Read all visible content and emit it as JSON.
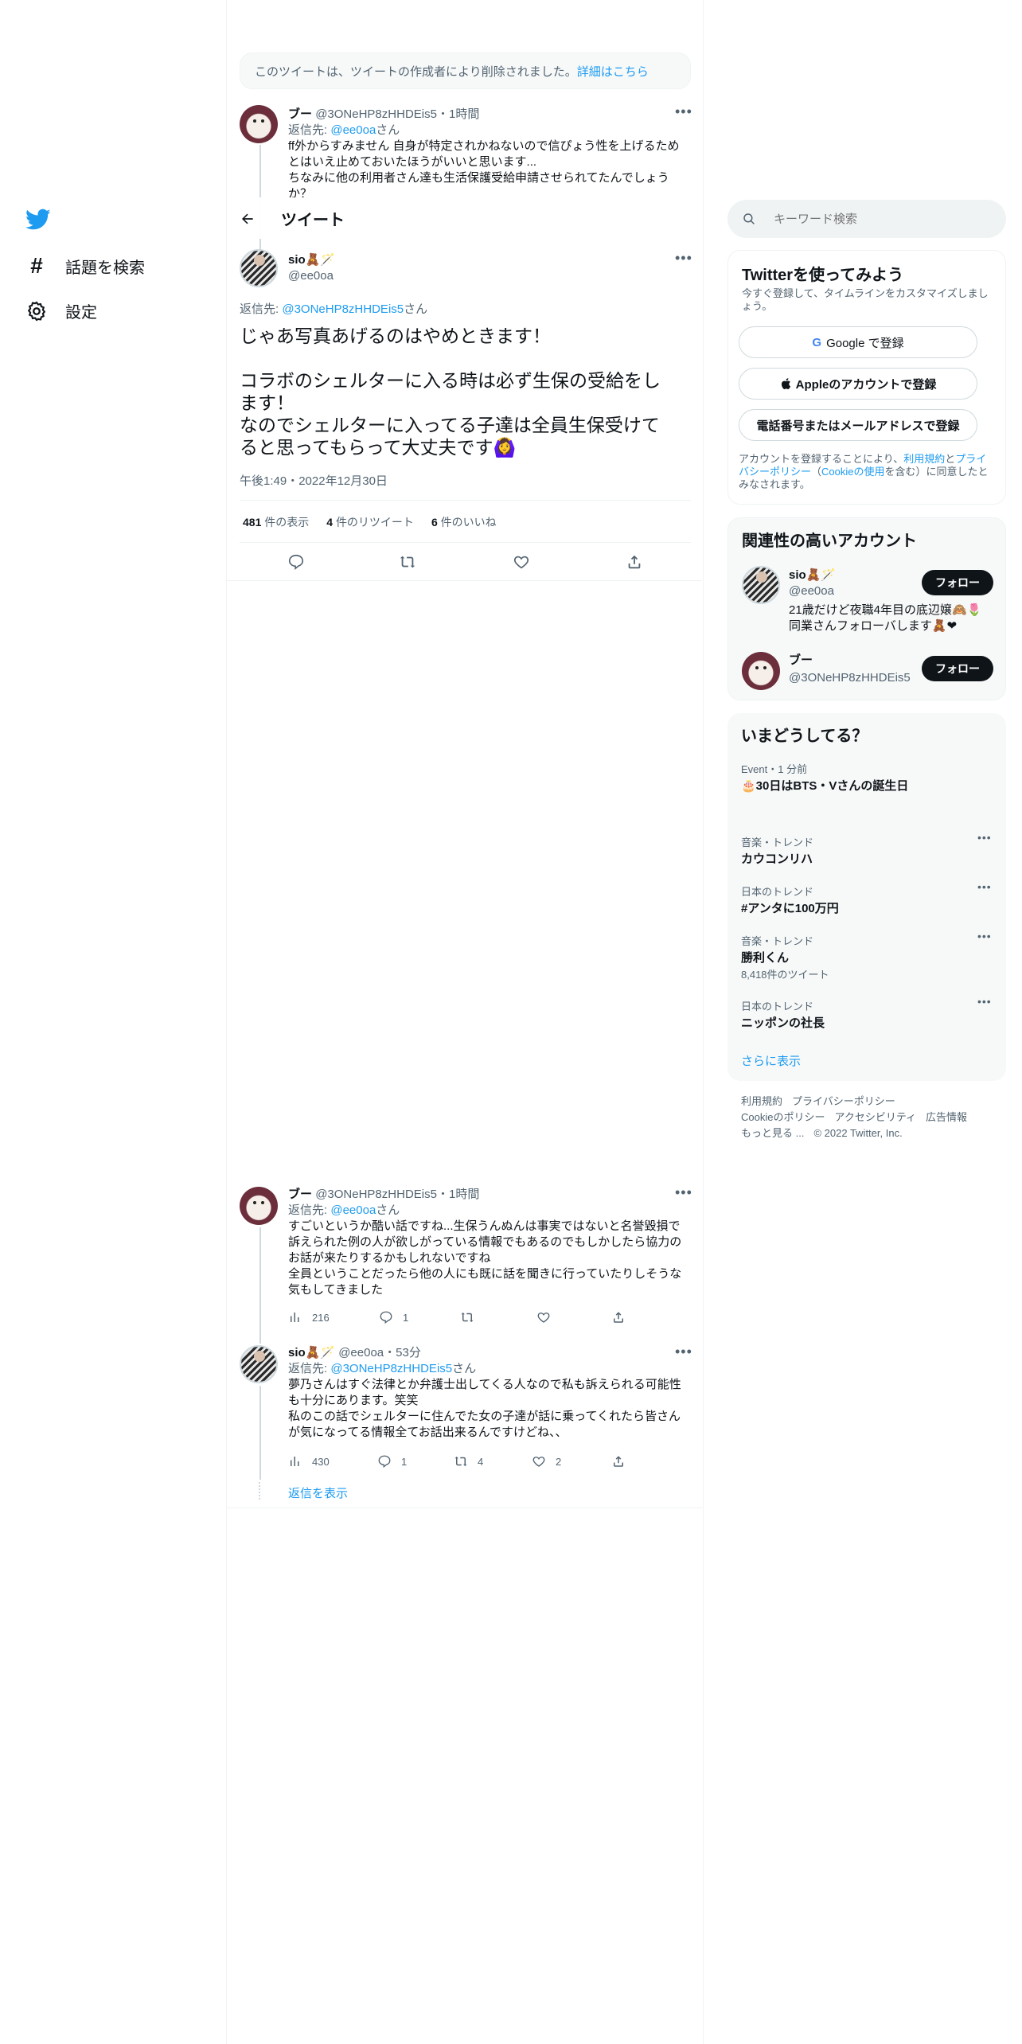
{
  "colors": {
    "accent": "#1d9bf0",
    "text": "#0f1419",
    "muted": "#536471",
    "border": "#eff3f4"
  },
  "nav": {
    "logo_icon": "twitter-bird-icon",
    "explore": "話題を検索",
    "settings": "設定"
  },
  "deleted_notice": {
    "text": "このツイートは、ツイートの作成者により削除されました。",
    "link": "詳細はこちら"
  },
  "parent_tweet": {
    "name": "ブー",
    "handle": "@3ONeHP8zHHDEis5",
    "time": "1時間",
    "reply_prefix": "返信先: ",
    "reply_to": "@ee0oa",
    "reply_suffix": "さん",
    "lines": [
      "ff外からすみません 自身が特定されかねないので信ぴょう性を上げるため",
      "とはいえ止めておいたほうがいいと思います...",
      "ちなみに他の利用者さん達も生活保護受給申請させられてたんでしょう",
      "か？"
    ]
  },
  "header": {
    "title": "ツイート"
  },
  "main_tweet": {
    "name": "sio🧸🪄",
    "handle": "@ee0oa",
    "reply_prefix": "返信先: ",
    "reply_to": "@3ONeHP8zHHDEis5",
    "reply_suffix": "さん",
    "lines": [
      "じゃあ写真あげるのはやめときます！",
      "",
      "コラボのシェルターに入る時は必ず生保の受給をし",
      "ます！",
      "なのでシェルターに入ってる子達は全員生保受けて",
      "ると思ってもらって大丈夫です🙆‍♀️"
    ],
    "timestamp": "午後1:49・2022年12月30日",
    "stats": {
      "views_count": "481",
      "views_label": "件の表示",
      "retweets_count": "4",
      "retweets_label": "件のリツイート",
      "likes_count": "6",
      "likes_label": "件のいいね"
    }
  },
  "replies": [
    {
      "name": "ブー",
      "handle": "@3ONeHP8zHHDEis5",
      "time": "1時間",
      "reply_prefix": "返信先: ",
      "reply_to": "@ee0oa",
      "reply_suffix": "さん",
      "lines": [
        "すごいというか酷い話ですね...生保うんぬんは事実ではないと名誉毀損で",
        "訴えられた例の人が欲しがっている情報でもあるのでもしかしたら協力の",
        "お話が来たりするかもしれないですね",
        "全員ということだったら他の人にも既に話を聞きに行っていたりしそうな",
        "気もしてきました"
      ],
      "views": "216",
      "replies": "1",
      "retweets": "",
      "likes": ""
    },
    {
      "name": "sio🧸🪄",
      "handle": "@ee0oa",
      "time": "53分",
      "reply_prefix": "返信先: ",
      "reply_to": "@3ONeHP8zHHDEis5",
      "reply_suffix": "さん",
      "lines": [
        "夢乃さんはすぐ法律とか弁護士出してくる人なので私も訴えられる可能性",
        "も十分にあります。笑笑",
        "私のこの話でシェルターに住んでた女の子達が話に乗ってくれたら皆さん",
        "が気になってる情報全てお話出来るんですけどね、、"
      ],
      "views": "430",
      "replies": "1",
      "retweets": "4",
      "likes": "2"
    }
  ],
  "show_replies": "返信を表示",
  "search": {
    "placeholder": "キーワード検索"
  },
  "signup": {
    "title": "Twitterを使ってみよう",
    "subtitle_1": "今すぐ登録して、タイムラインをカスタマイズしまし",
    "subtitle_2": "ょう。",
    "google": "Google で登録",
    "apple": "Appleのアカウントで登録",
    "phone": "電話番号またはメールアドレスで登録",
    "legal_1": "アカウントを登録することにより、",
    "legal_terms": "利用規約",
    "legal_2": "と",
    "legal_privacy": "プライ",
    "legal_privacy_2": "バシーポリシー",
    "legal_3": "（",
    "legal_cookie": "Cookieの使用",
    "legal_4": "を含む）に同意したと",
    "legal_5": "みなされます。"
  },
  "related": {
    "title": "関連性の高いアカウント",
    "follow": "フォロー",
    "accounts": [
      {
        "name": "sio🧸🪄",
        "handle": "@ee0oa",
        "bio_1": "21歳だけど夜職4年目の底辺嬢🙈🌷",
        "bio_2": "同業さんフォローバします🧸❤"
      },
      {
        "name": "ブー",
        "handle": "@3ONeHP8zHHDEis5",
        "bio_1": "",
        "bio_2": ""
      }
    ]
  },
  "trends": {
    "title": "いまどうしてる？",
    "items": [
      {
        "category": "Event・1 分前",
        "title": "🎂30日はBTS・Vさんの誕生日",
        "count": ""
      },
      {
        "category": "音楽・トレンド",
        "title": "カウコンリハ",
        "count": ""
      },
      {
        "category": "日本のトレンド",
        "title": "#アンタに100万円",
        "count": ""
      },
      {
        "category": "音楽・トレンド",
        "title": "勝利くん",
        "count": "8,418件のツイート"
      },
      {
        "category": "日本のトレンド",
        "title": "ニッポンの社長",
        "count": ""
      }
    ],
    "show_more": "さらに表示"
  },
  "footer": {
    "terms": "利用規約",
    "privacy": "プライバシーポリシー",
    "cookie": "Cookieのポリシー",
    "accessibility": "アクセシビリティ",
    "ads": "広告情報",
    "more": "もっと見る ...",
    "copyright": "© 2022 Twitter, Inc."
  }
}
